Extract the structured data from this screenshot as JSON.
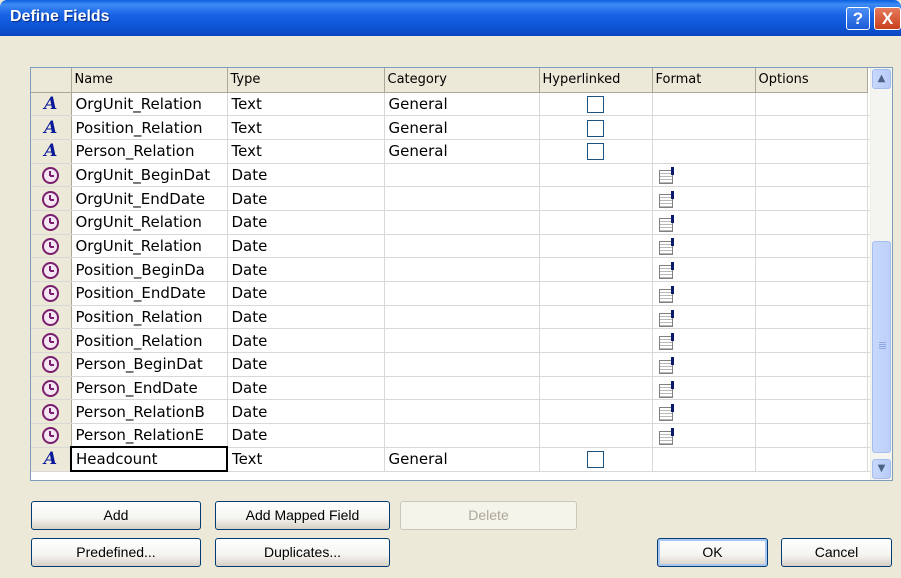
{
  "window": {
    "title": "Define Fields"
  },
  "titlebar": {
    "help_glyph": "?",
    "close_glyph": "X"
  },
  "grid": {
    "columns": [
      "Name",
      "Type",
      "Category",
      "Hyperlinked",
      "Format",
      "Options"
    ],
    "rows": [
      {
        "icon": "text-type-icon",
        "name": "OrgUnit_Relation",
        "type": "Text",
        "category": "General",
        "hyperlinked": false,
        "format": false
      },
      {
        "icon": "text-type-icon",
        "name": "Position_Relation",
        "type": "Text",
        "category": "General",
        "hyperlinked": false,
        "format": false
      },
      {
        "icon": "text-type-icon",
        "name": "Person_Relation",
        "type": "Text",
        "category": "General",
        "hyperlinked": false,
        "format": false
      },
      {
        "icon": "clock-icon",
        "name": "OrgUnit_BeginDat",
        "type": "Date",
        "category": "",
        "hyperlinked": null,
        "format": true
      },
      {
        "icon": "clock-icon",
        "name": "OrgUnit_EndDate",
        "type": "Date",
        "category": "",
        "hyperlinked": null,
        "format": true
      },
      {
        "icon": "clock-icon",
        "name": "OrgUnit_Relation",
        "type": "Date",
        "category": "",
        "hyperlinked": null,
        "format": true
      },
      {
        "icon": "clock-icon",
        "name": "OrgUnit_Relation",
        "type": "Date",
        "category": "",
        "hyperlinked": null,
        "format": true
      },
      {
        "icon": "clock-icon",
        "name": "Position_BeginDa",
        "type": "Date",
        "category": "",
        "hyperlinked": null,
        "format": true
      },
      {
        "icon": "clock-icon",
        "name": "Position_EndDate",
        "type": "Date",
        "category": "",
        "hyperlinked": null,
        "format": true
      },
      {
        "icon": "clock-icon",
        "name": "Position_Relation",
        "type": "Date",
        "category": "",
        "hyperlinked": null,
        "format": true
      },
      {
        "icon": "clock-icon",
        "name": "Position_Relation",
        "type": "Date",
        "category": "",
        "hyperlinked": null,
        "format": true
      },
      {
        "icon": "clock-icon",
        "name": "Person_BeginDat",
        "type": "Date",
        "category": "",
        "hyperlinked": null,
        "format": true
      },
      {
        "icon": "clock-icon",
        "name": "Person_EndDate",
        "type": "Date",
        "category": "",
        "hyperlinked": null,
        "format": true
      },
      {
        "icon": "clock-icon",
        "name": "Person_RelationB",
        "type": "Date",
        "category": "",
        "hyperlinked": null,
        "format": true
      },
      {
        "icon": "clock-icon",
        "name": "Person_RelationE",
        "type": "Date",
        "category": "",
        "hyperlinked": null,
        "format": true
      },
      {
        "icon": "text-type-icon",
        "name": "Headcount",
        "type": "Text",
        "category": "General",
        "hyperlinked": false,
        "format": false,
        "editing": true
      }
    ]
  },
  "buttons": {
    "add": "Add",
    "add_mapped_field": "Add Mapped Field",
    "delete": "Delete",
    "predefined": "Predefined...",
    "duplicates": "Duplicates...",
    "ok": "OK",
    "cancel": "Cancel"
  },
  "colors": {
    "titlebar": "#0a54d4",
    "text_type_icon": "#0a1a9a",
    "clock_icon": "#7a1f6e",
    "dialog_bg": "#ece9d8"
  }
}
